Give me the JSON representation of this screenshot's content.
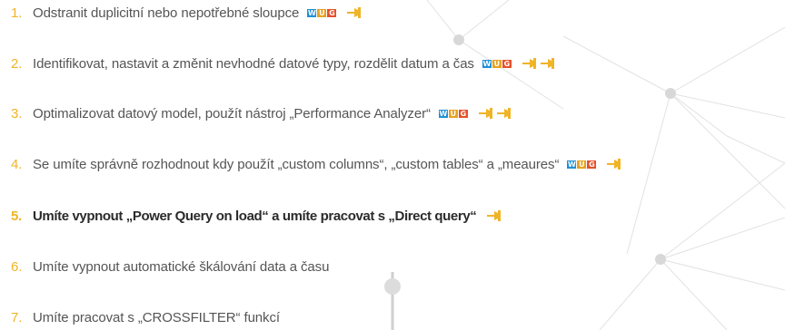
{
  "colors": {
    "number": "#f0b427",
    "text": "#555555",
    "highlight_text": "#2b2b2b",
    "badge_w": "#1f8fd6",
    "badge_u": "#e6a21f",
    "badge_g": "#e5502a",
    "pin": "#f0b427",
    "network": "#dddddd"
  },
  "items": [
    {
      "number": "1.",
      "text": "Odstranit duplicitní nebo nepotřebné sloupce",
      "badges": true,
      "pins": 1,
      "highlight": false
    },
    {
      "number": "2.",
      "text": "Identifikovat, nastavit a změnit nevhodné datové typy, rozdělit datum a čas",
      "badges": true,
      "pins": 2,
      "highlight": false
    },
    {
      "number": "3.",
      "text": "Optimalizovat datový model, použít nástroj „Performance Analyzer“",
      "badges": true,
      "pins": 2,
      "highlight": false
    },
    {
      "number": "4.",
      "text": "Se umíte správně rozhodnout kdy použít „custom columns“, „custom tables“ a „meaures“",
      "badges": true,
      "pins": 1,
      "highlight": false
    },
    {
      "number": "5.",
      "text": "Umíte vypnout „Power Query on load“ a umíte pracovat s „Direct query“",
      "badges": false,
      "pins": 1,
      "highlight": true
    },
    {
      "number": "6.",
      "text": "Umíte vypnout automatické škálování data a času",
      "badges": false,
      "pins": 0,
      "highlight": false
    },
    {
      "number": "7.",
      "text": "Umíte pracovat s „CROSSFILTER“ funkcí",
      "badges": false,
      "pins": 0,
      "highlight": false
    }
  ],
  "badge_letters": [
    "W",
    "U",
    "G"
  ],
  "icons": {
    "badge": "wug-logo-icon",
    "pin": "pin-icon"
  }
}
